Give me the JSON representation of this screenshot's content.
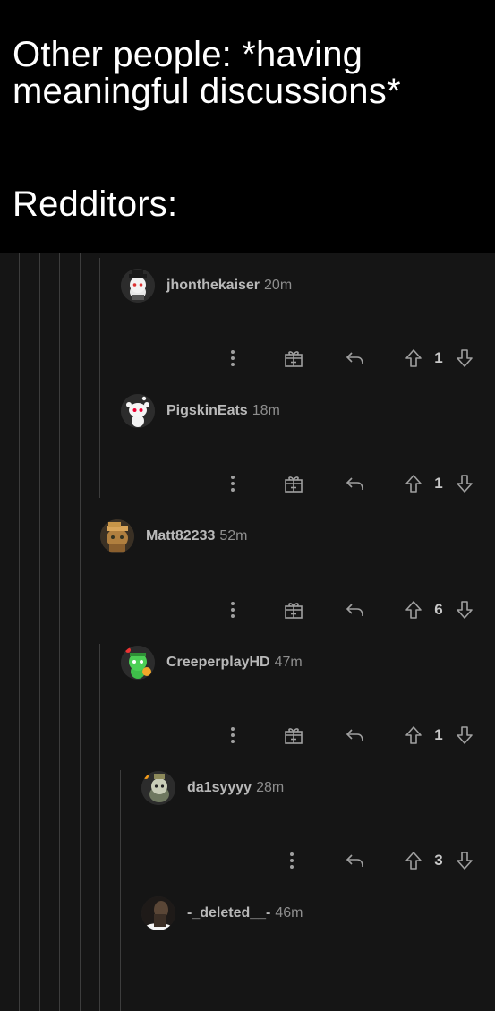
{
  "meme": {
    "line1": "Other people: *having meaningful discussions*",
    "line2": "Redditors:"
  },
  "colors": {
    "header_bg": "#000000",
    "thread_bg": "#151515",
    "thread_line": "#3d3d3d",
    "icon": "#9a9a9a"
  },
  "comments": [
    {
      "username": "jhonthekaiser",
      "age": "20m",
      "votes": "1",
      "avatar": "snoo-hat-avatar"
    },
    {
      "username": "PigskinEats",
      "age": "18m",
      "votes": "1",
      "avatar": "snoo-default-avatar"
    },
    {
      "username": "Matt82233",
      "age": "52m",
      "votes": "6",
      "avatar": "snoo-brown-avatar"
    },
    {
      "username": "CreeperplayHD",
      "age": "47m",
      "votes": "1",
      "avatar": "snoo-green-avatar"
    },
    {
      "username": "da1syyyy",
      "age": "28m",
      "votes": "3",
      "avatar": "snoo-armor-avatar"
    },
    {
      "username": "-_deleted__-",
      "age": "46m",
      "avatar": "dark-photo-avatar"
    }
  ],
  "icons": {
    "more": "more-options-icon",
    "award": "award-gift-icon",
    "reply": "reply-arrow-icon",
    "upvote": "upvote-arrow-icon",
    "downvote": "downvote-arrow-icon"
  }
}
